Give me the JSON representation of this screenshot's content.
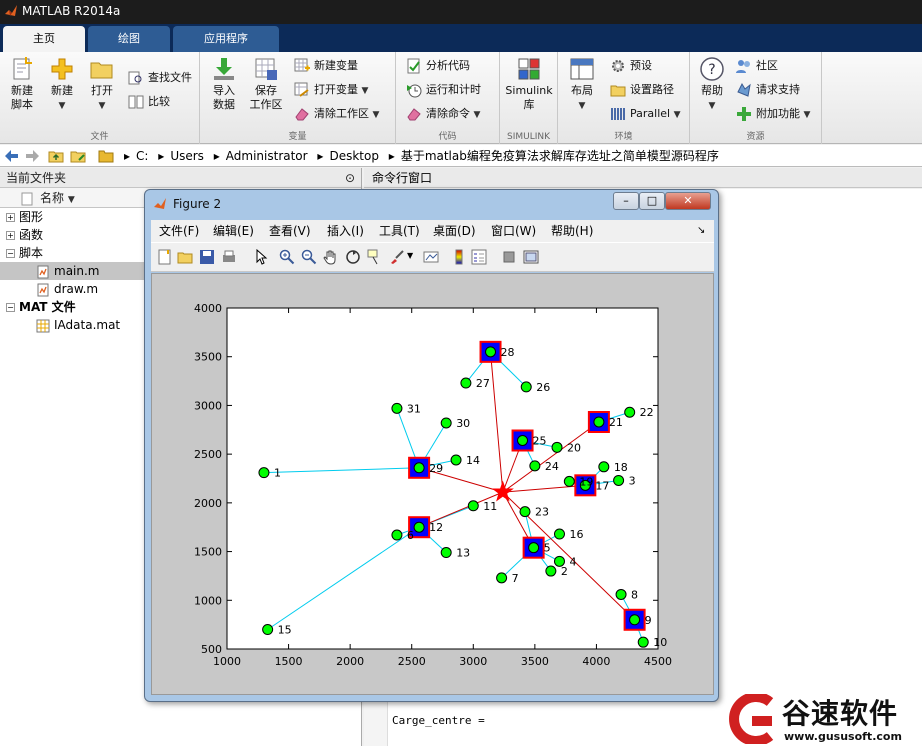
{
  "window": {
    "title": "MATLAB R2014a"
  },
  "tabs": [
    {
      "label": "主页",
      "active": true
    },
    {
      "label": "绘图",
      "active": false
    },
    {
      "label": "应用程序",
      "active": false
    }
  ],
  "ribbon": {
    "file": {
      "caption": "文件",
      "new_script": [
        "新建",
        "脚本"
      ],
      "new": "新建",
      "open": "打开",
      "find_files": "查找文件",
      "compare": "比较"
    },
    "variable": {
      "caption": "变量",
      "import": [
        "导入",
        "数据"
      ],
      "save": [
        "保存",
        "工作区"
      ],
      "new_var": "新建变量",
      "open_var": "打开变量",
      "clear_ws": "清除工作区"
    },
    "code": {
      "caption": "代码",
      "analyze": "分析代码",
      "run_time": "运行和计时",
      "clear_cmd": "清除命令"
    },
    "simulink": {
      "caption": "SIMULINK",
      "library": [
        "Simulink",
        "库"
      ]
    },
    "env": {
      "caption": "环境",
      "layout": "布局",
      "prefs": "预设",
      "set_path": "设置路径",
      "parallel": "Parallel"
    },
    "resources": {
      "caption": "资源",
      "help": "帮助",
      "community": "社区",
      "support": "请求支持",
      "addons": "附加功能"
    }
  },
  "address": {
    "segments": [
      "C:",
      "Users",
      "Administrator",
      "Desktop",
      "基于matlab编程免疫算法求解库存选址之简单模型源码程序"
    ]
  },
  "left_panel": {
    "title": "当前文件夹",
    "col_header": "名称",
    "tree": [
      {
        "label": "图形",
        "type": "folder",
        "level": 0,
        "expander": "+"
      },
      {
        "label": "函数",
        "type": "folder",
        "level": 0,
        "expander": "+"
      },
      {
        "label": "脚本",
        "type": "folder",
        "level": 0,
        "expander": "−"
      },
      {
        "label": "main.m",
        "type": "mfile",
        "level": 1,
        "selected": true
      },
      {
        "label": "draw.m",
        "type": "mfile",
        "level": 1
      },
      {
        "label": "MAT 文件",
        "type": "folder",
        "level": 0,
        "expander": "−",
        "bold": true
      },
      {
        "label": "IAdata.mat",
        "type": "matfile",
        "level": 1
      }
    ]
  },
  "command_window": {
    "title": "命令行窗口",
    "text": "Carge_centre ="
  },
  "figure": {
    "title": "Figure 2",
    "menu": [
      "文件(F)",
      "编辑(E)",
      "查看(V)",
      "插入(I)",
      "工具(T)",
      "桌面(D)",
      "窗口(W)",
      "帮助(H)"
    ],
    "chart_data": {
      "type": "scatter",
      "xlim": [
        1000,
        4500
      ],
      "ylim": [
        500,
        4000
      ],
      "xticks": [
        "1000",
        "1500",
        "2000",
        "2500",
        "3000",
        "3500",
        "4000",
        "4500"
      ],
      "yticks": [
        "500",
        "1000",
        "1500",
        "2000",
        "2500",
        "3000",
        "3500",
        "4000"
      ],
      "grid": false,
      "points": [
        {
          "id": "1",
          "x": 1300,
          "y": 2310
        },
        {
          "id": "2",
          "x": 3630,
          "y": 1300
        },
        {
          "id": "3",
          "x": 4180,
          "y": 2230
        },
        {
          "id": "4",
          "x": 3700,
          "y": 1400
        },
        {
          "id": "5",
          "x": 3490,
          "y": 1540
        },
        {
          "id": "6",
          "x": 2380,
          "y": 1670
        },
        {
          "id": "7",
          "x": 3230,
          "y": 1230
        },
        {
          "id": "8",
          "x": 4200,
          "y": 1060
        },
        {
          "id": "9",
          "x": 4310,
          "y": 800
        },
        {
          "id": "10",
          "x": 4380,
          "y": 570
        },
        {
          "id": "11",
          "x": 3000,
          "y": 1970
        },
        {
          "id": "12",
          "x": 2560,
          "y": 1750
        },
        {
          "id": "13",
          "x": 2780,
          "y": 1490
        },
        {
          "id": "14",
          "x": 2860,
          "y": 2440
        },
        {
          "id": "15",
          "x": 1330,
          "y": 700
        },
        {
          "id": "16",
          "x": 3700,
          "y": 1680
        },
        {
          "id": "17",
          "x": 3910,
          "y": 2180
        },
        {
          "id": "18",
          "x": 4060,
          "y": 2370
        },
        {
          "id": "19",
          "x": 3780,
          "y": 2220
        },
        {
          "id": "20",
          "x": 3680,
          "y": 2570
        },
        {
          "id": "21",
          "x": 4020,
          "y": 2830
        },
        {
          "id": "22",
          "x": 4270,
          "y": 2930
        },
        {
          "id": "23",
          "x": 3420,
          "y": 1910
        },
        {
          "id": "24",
          "x": 3500,
          "y": 2380
        },
        {
          "id": "25",
          "x": 3400,
          "y": 2640
        },
        {
          "id": "26",
          "x": 3430,
          "y": 3190
        },
        {
          "id": "27",
          "x": 2940,
          "y": 3230
        },
        {
          "id": "28",
          "x": 3140,
          "y": 3550
        },
        {
          "id": "29",
          "x": 2560,
          "y": 2360
        },
        {
          "id": "30",
          "x": 2780,
          "y": 2820
        },
        {
          "id": "31",
          "x": 2380,
          "y": 2970
        }
      ],
      "centers": [
        "28",
        "25",
        "21",
        "17",
        "29",
        "12",
        "5",
        "9"
      ],
      "hub": {
        "x": 3240,
        "y": 2110
      },
      "links": [
        [
          "1",
          "29"
        ],
        [
          "31",
          "29"
        ],
        [
          "30",
          "29"
        ],
        [
          "14",
          "29"
        ],
        [
          "15",
          "12"
        ],
        [
          "6",
          "12"
        ],
        [
          "13",
          "12"
        ],
        [
          "11",
          "12"
        ],
        [
          "27",
          "28"
        ],
        [
          "26",
          "28"
        ],
        [
          "20",
          "25"
        ],
        [
          "24",
          "25"
        ],
        [
          "22",
          "21"
        ],
        [
          "3",
          "17"
        ],
        [
          "18",
          "17"
        ],
        [
          "19",
          "17"
        ],
        [
          "7",
          "5"
        ],
        [
          "2",
          "5"
        ],
        [
          "4",
          "5"
        ],
        [
          "23",
          "5"
        ],
        [
          "16",
          "5"
        ],
        [
          "8",
          "9"
        ],
        [
          "10",
          "9"
        ]
      ],
      "colors": {
        "point_fill": "#00ff00",
        "center_fill": "#0000ff",
        "center_border": "#ff0000",
        "link": "#00ccee",
        "hub_link": "#cc0000",
        "hub": "#ff0000"
      }
    }
  },
  "watermark": {
    "name": "谷速软件",
    "url": "www.gususoft.com"
  }
}
